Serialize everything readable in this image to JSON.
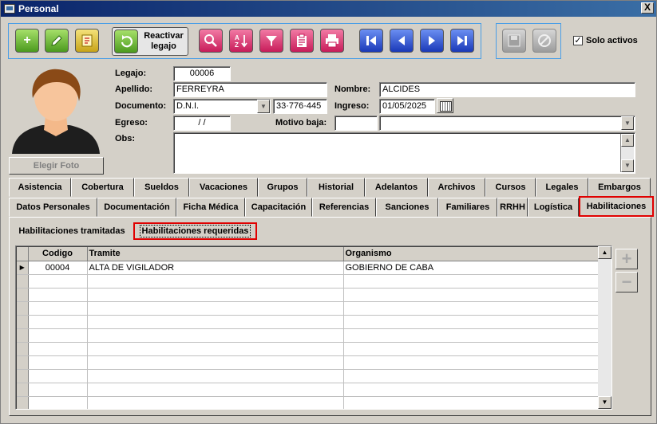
{
  "window": {
    "title": "Personal",
    "close_label": "X"
  },
  "toolbar": {
    "reactivar_label": "Reactivar legajo",
    "solo_activos_label": "Solo activos",
    "solo_activos_checked": "✓"
  },
  "photo": {
    "button_label": "Elegir Foto"
  },
  "form": {
    "legajo_label": "Legajo:",
    "legajo_value": "00006",
    "apellido_label": "Apellido:",
    "apellido_value": "FERREYRA",
    "nombre_label": "Nombre:",
    "nombre_value": "ALCIDES",
    "documento_label": "Documento:",
    "documento_tipo": "D.N.I.",
    "documento_numero": "33·776·445",
    "ingreso_label": "Ingreso:",
    "ingreso_value": "01/05/2025",
    "egreso_label": "Egreso:",
    "egreso_value": "/ /",
    "motivo_baja_label": "Motivo baja:",
    "motivo_baja_code": "",
    "motivo_baja_value": "",
    "obs_label": "Obs:",
    "obs_value": ""
  },
  "tabs_row1": [
    {
      "label": "Asistencia"
    },
    {
      "label": "Cobertura"
    },
    {
      "label": "Sueldos"
    },
    {
      "label": "Vacaciones"
    },
    {
      "label": "Grupos"
    },
    {
      "label": "Historial"
    },
    {
      "label": "Adelantos"
    },
    {
      "label": "Archivos"
    },
    {
      "label": "Cursos"
    },
    {
      "label": "Legales"
    },
    {
      "label": "Embargos"
    }
  ],
  "tabs_row2": [
    {
      "label": "Datos Personales"
    },
    {
      "label": "Documentación"
    },
    {
      "label": "Ficha Médica"
    },
    {
      "label": "Capacitación"
    },
    {
      "label": "Referencias"
    },
    {
      "label": "Sanciones"
    },
    {
      "label": "Familiares"
    },
    {
      "label": "RRHH"
    },
    {
      "label": "Logística"
    },
    {
      "label": "Habilitaciones",
      "active": true
    }
  ],
  "subtabs": [
    {
      "label": "Habilitaciones tramitadas"
    },
    {
      "label": "Habilitaciones requeridas",
      "active": true
    }
  ],
  "grid": {
    "columns": [
      "Codigo",
      "Tramite",
      "Organismo"
    ],
    "rows": [
      {
        "codigo": "00004",
        "tramite": "ALTA DE VIGILADOR",
        "organismo": "GOBIERNO DE CABA"
      }
    ]
  },
  "icons": {
    "add": "plus-icon",
    "edit": "pencil-icon",
    "note": "note-icon",
    "reactivate": "refresh-icon",
    "search": "magnifier-icon",
    "sort": "sort-az-icon",
    "filter": "funnel-icon",
    "report": "clipboard-icon",
    "print": "printer-icon",
    "first": "first-record-icon",
    "prev": "prev-record-icon",
    "next": "next-record-icon",
    "last": "last-record-icon",
    "save": "save-icon",
    "cancel": "cancel-icon"
  }
}
